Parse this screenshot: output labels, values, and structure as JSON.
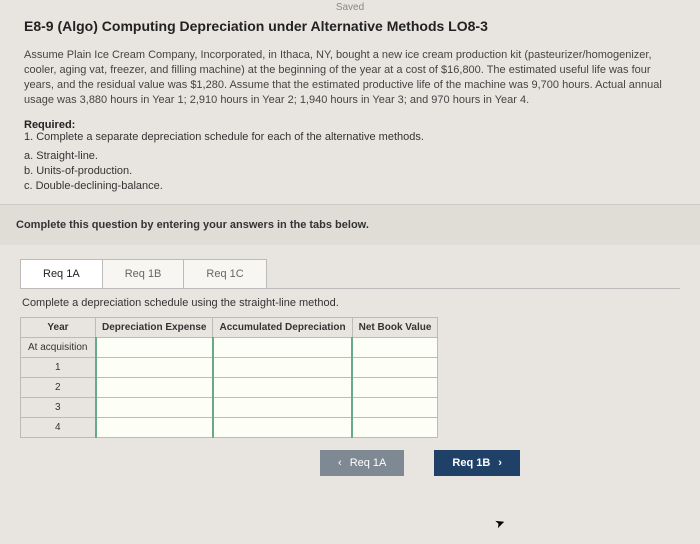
{
  "saved_label": "Saved",
  "title": "E8-9 (Algo) Computing Depreciation under Alternative Methods LO8-3",
  "passage": "Assume Plain Ice Cream Company, Incorporated, in Ithaca, NY, bought a new ice cream production kit (pasteurizer/homogenizer, cooler, aging vat, freezer, and filling machine) at the beginning of the year at a cost of $16,800. The estimated useful life was four years, and the residual value was $1,280. Assume that the estimated productive life of the machine was 9,700 hours. Actual annual usage was 3,880 hours in Year 1; 2,910 hours in Year 2; 1,940 hours in Year 3; and 970 hours in Year 4.",
  "required_heading": "Required:",
  "required_line": "1. Complete a separate depreciation schedule for each of the alternative methods.",
  "methods": {
    "a": "a. Straight-line.",
    "b": "b. Units-of-production.",
    "c": "c. Double-declining-balance."
  },
  "instruction_box": "Complete this question by entering your answers in the tabs below.",
  "tabs": {
    "a": "Req 1A",
    "b": "Req 1B",
    "c": "Req 1C"
  },
  "tab_instruction": "Complete a depreciation schedule using the straight-line method.",
  "table": {
    "headers": {
      "year": "Year",
      "expense": "Depreciation Expense",
      "accum": "Accumulated Depreciation",
      "nbv": "Net Book Value"
    },
    "rows": [
      "At acquisition",
      "1",
      "2",
      "3",
      "4"
    ]
  },
  "nav": {
    "prev": "Req 1A",
    "next": "Req 1B"
  },
  "chart_data": {
    "type": "table",
    "title": "Straight-line depreciation schedule (blank input grid)",
    "columns": [
      "Year",
      "Depreciation Expense",
      "Accumulated Depreciation",
      "Net Book Value"
    ],
    "rows": [
      {
        "Year": "At acquisition",
        "Depreciation Expense": null,
        "Accumulated Depreciation": null,
        "Net Book Value": null
      },
      {
        "Year": "1",
        "Depreciation Expense": null,
        "Accumulated Depreciation": null,
        "Net Book Value": null
      },
      {
        "Year": "2",
        "Depreciation Expense": null,
        "Accumulated Depreciation": null,
        "Net Book Value": null
      },
      {
        "Year": "3",
        "Depreciation Expense": null,
        "Accumulated Depreciation": null,
        "Net Book Value": null
      },
      {
        "Year": "4",
        "Depreciation Expense": null,
        "Accumulated Depreciation": null,
        "Net Book Value": null
      }
    ]
  }
}
